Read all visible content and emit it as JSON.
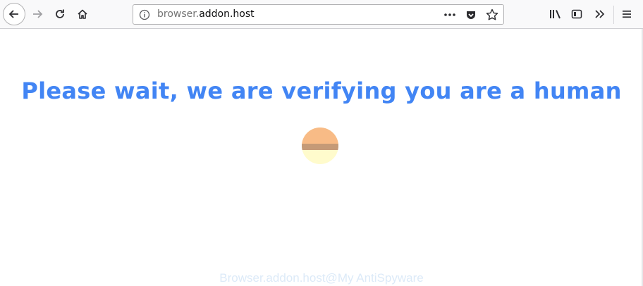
{
  "browser": {
    "url_prefix": "browser.",
    "url_host": "addon.host",
    "toolbar_icons": [
      "back-icon",
      "forward-icon",
      "reload-icon",
      "home-icon",
      "info-icon",
      "page-actions-icon",
      "pocket-icon",
      "bookmark-star-icon",
      "library-icon",
      "sidebar-icon",
      "overflow-icon",
      "menu-icon"
    ]
  },
  "page": {
    "headline": "Please wait, we are verifying you are a human",
    "watermark": "Browser.addon.host@My AntiSpyware"
  },
  "colors": {
    "headline": "#4285f4",
    "spinner_top": "#f8bb86",
    "spinner_band": "#c59a77",
    "spinner_bottom": "#fffbcc"
  }
}
